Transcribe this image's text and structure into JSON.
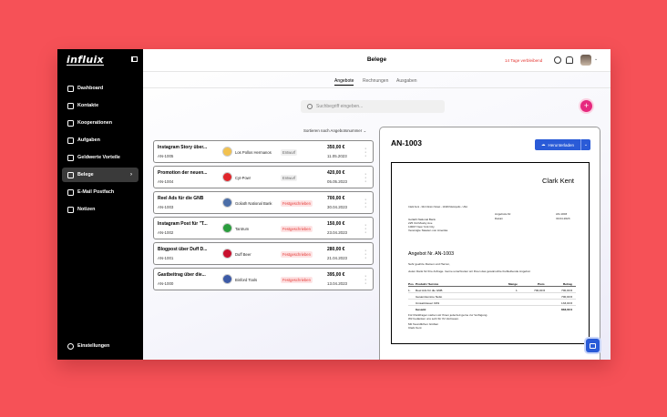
{
  "sidebar": {
    "logo": "influix",
    "items": [
      {
        "label": "Dashboard",
        "icon": "dashboard-icon"
      },
      {
        "label": "Kontakte",
        "icon": "contacts-icon"
      },
      {
        "label": "Kooperationen",
        "icon": "cooperation-icon"
      },
      {
        "label": "Aufgaben",
        "icon": "tasks-icon"
      },
      {
        "label": "Geldwerte Vorteile",
        "icon": "benefits-icon"
      },
      {
        "label": "Belege",
        "icon": "receipts-icon",
        "active": true
      },
      {
        "label": "E-Mail Postfach",
        "icon": "mail-icon"
      },
      {
        "label": "Notizen",
        "icon": "notes-icon"
      }
    ],
    "settings": "Einstellungen"
  },
  "header": {
    "title": "Belege",
    "trial": "14 Tage verbleibend"
  },
  "tabs": [
    {
      "label": "Angebote",
      "active": true
    },
    {
      "label": "Rechnungen"
    },
    {
      "label": "Ausgaben"
    }
  ],
  "search": {
    "placeholder": "Suchbegriff eingeben..."
  },
  "sort": {
    "label": "Sortieren nach Angebotsnummer"
  },
  "rows": [
    {
      "title": "Instagram Story über...",
      "number": "AN-1005",
      "client": "Los Pollos Hermanos",
      "status": "Entwurf",
      "amount": "350,00 €",
      "date": "11.05.2023"
    },
    {
      "title": "Promotion der neuen...",
      "number": "AN-1004",
      "client": "Cyt-Pow!",
      "status": "Entwurf",
      "amount": "420,00 €",
      "date": "05.05.2023"
    },
    {
      "title": "Reel Ads für die GNB",
      "number": "AN-1003",
      "client": "Goliath National Bank",
      "status": "Festgeschrieben",
      "amount": "700,00 €",
      "date": "30.04.2023"
    },
    {
      "title": "Instagram Post für \"T...",
      "number": "AN-1002",
      "client": "Tantrum",
      "status": "Festgeschrieben",
      "amount": "150,00 €",
      "date": "23.04.2023"
    },
    {
      "title": "Blogpost über Duff D...",
      "number": "AN-1001",
      "client": "Duff Beer",
      "status": "Festgeschrieben",
      "amount": "280,00 €",
      "date": "21.04.2023"
    },
    {
      "title": "Gastbeitrag über die...",
      "number": "AN-1000",
      "client": "Binford Tools",
      "status": "Festgeschrieben",
      "amount": "395,00 €",
      "date": "13.04.2023"
    }
  ],
  "detail": {
    "title": "AN-1003",
    "download": "Herunterladen",
    "doc": {
      "sender_name": "Clark Kent",
      "sender_line": "Clark Kent - 344 Clinton Street - 10109 Metropolis - USA",
      "recipient": [
        "Goliath National Bank",
        "225 3rd Mosby Ave",
        "10007 New York City",
        "Vereinigte Staaten von Amerika"
      ],
      "meta": [
        {
          "label": "Angebots-Nr.",
          "value": "AN-1003"
        },
        {
          "label": "Datum",
          "value": "30.04.2023"
        }
      ],
      "offer_title": "Angebot Nr. AN-1003",
      "greeting": "Sehr geehrte Damen und Herren,",
      "intro": "vielen Dank für Ihre Anfrage. Gerne unterbreiten wir Ihnen das gewünschte freibleibende Angebot:",
      "columns": [
        "Pos.",
        "Produkt / Service",
        "Menge",
        "Preis",
        "Betrag"
      ],
      "items": [
        {
          "pos": "1.",
          "product": "Reel Ads für die GNB",
          "qty": "1",
          "price": "700,00 €",
          "total": "700,00 €"
        }
      ],
      "summary": [
        {
          "label": "Gesamtsumme Netto",
          "value": "700,00 €"
        },
        {
          "label": "Umsatzsteuer 19%",
          "value": "133,00 €"
        },
        {
          "label": "Gesamt",
          "value": "833,00 €"
        }
      ],
      "closing": [
        "Für Rückfragen stehen wir Ihnen jederzeit gerne zur Verfügung.",
        "Wir bedanken uns sehr für Ihr Vertrauen.",
        "Mit freundlichen Grüßen",
        "Clark Kent"
      ]
    }
  },
  "colors": {
    "accent": "#e6287e",
    "primary": "#2a5bd7",
    "status_final": "#e53935",
    "background": "#f65157"
  }
}
